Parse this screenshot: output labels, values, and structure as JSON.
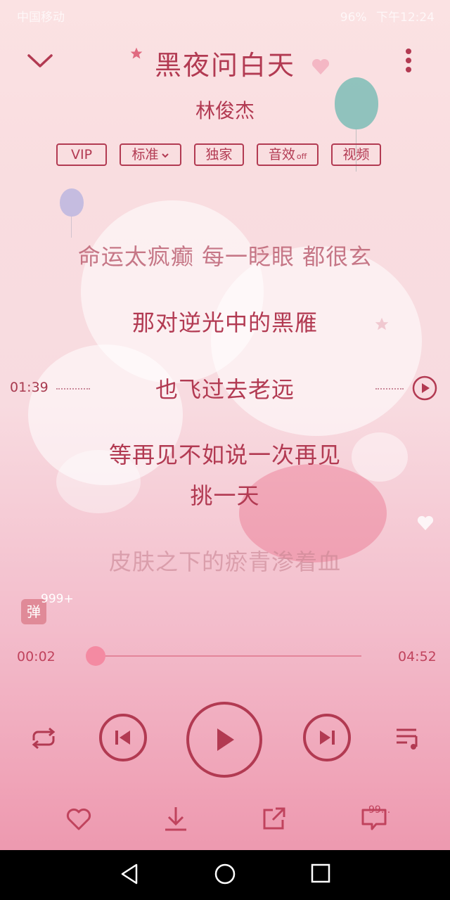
{
  "status_bar": {
    "carrier": "中国移动",
    "battery": "96%",
    "time": "下午12:24"
  },
  "song": {
    "title": "黑夜问白天",
    "artist": "林俊杰"
  },
  "tags": [
    {
      "label": "VIP"
    },
    {
      "label": "标准"
    },
    {
      "label": "独家"
    },
    {
      "label": "音效",
      "sub": "off"
    },
    {
      "label": "视频"
    }
  ],
  "lyrics": {
    "line_prev": "命运太疯癫 每一眨眼 都很玄",
    "line_1": "那对逆光中的黑雁",
    "line_current": "也飞过去老远",
    "line_3a": "等再见不如说一次再见",
    "line_3b": "挑一天",
    "line_next": "皮肤之下的瘀青渗着血"
  },
  "lyric_seek": {
    "timestamp": "01:39"
  },
  "danmu": {
    "label": "弹",
    "count": "999+"
  },
  "progress": {
    "current": "00:02",
    "total": "04:52",
    "fraction": 0.007
  },
  "comments": {
    "count": "99..."
  },
  "icons": {
    "collapse": "chevron-down-icon",
    "more": "more-vertical-icon",
    "repeat": "repeat-icon",
    "prev": "previous-icon",
    "play": "play-icon",
    "next": "next-icon",
    "playlist": "playlist-icon",
    "like": "heart-icon",
    "download": "download-icon",
    "share": "share-icon",
    "comment": "comment-icon"
  },
  "colors": {
    "accent": "#b23a52",
    "progress": "#f06a86"
  }
}
